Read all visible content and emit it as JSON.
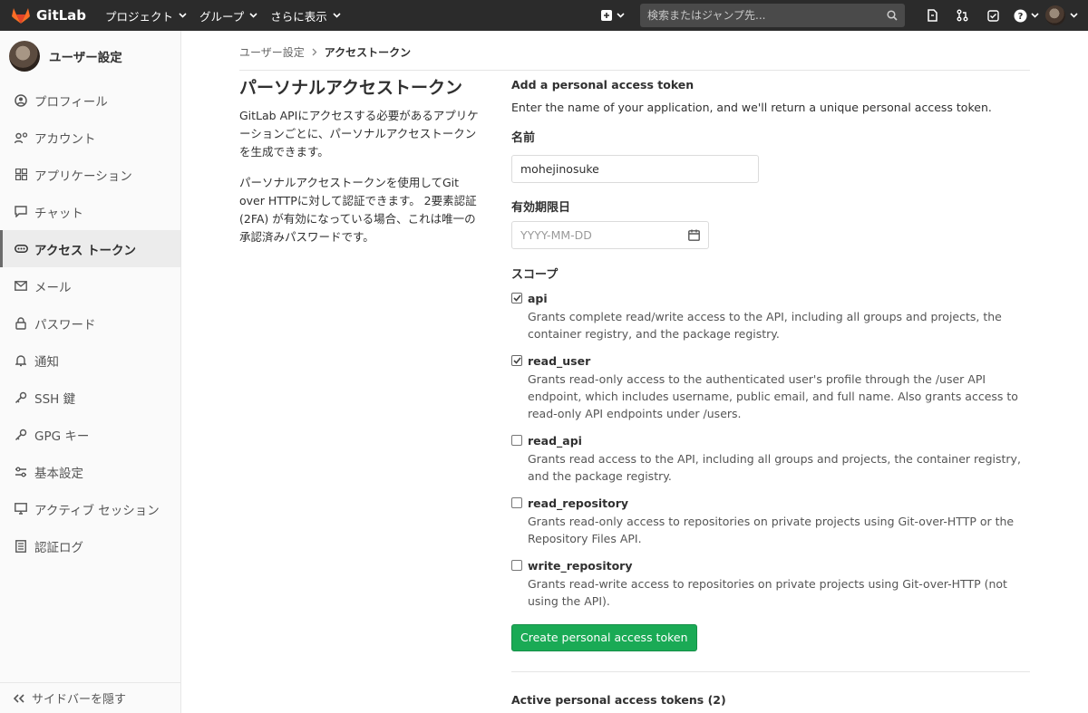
{
  "navbar": {
    "brand": "GitLab",
    "menus": [
      {
        "label": "プロジェクト"
      },
      {
        "label": "グループ"
      },
      {
        "label": "さらに表示"
      }
    ],
    "search_placeholder": "検索またはジャンプ先...",
    "icons": [
      "plus-icon",
      "search-icon",
      "todo-icon",
      "merge-request-icon",
      "issue-icon",
      "help-icon",
      "user-avatar"
    ]
  },
  "sidebar": {
    "title": "ユーザー設定",
    "items": [
      {
        "label": "プロフィール",
        "icon": "profile-icon"
      },
      {
        "label": "アカウント",
        "icon": "account-icon"
      },
      {
        "label": "アプリケーション",
        "icon": "applications-icon"
      },
      {
        "label": "チャット",
        "icon": "chat-icon"
      },
      {
        "label": "アクセス トークン",
        "icon": "token-icon",
        "active": true
      },
      {
        "label": "メール",
        "icon": "mail-icon"
      },
      {
        "label": "パスワード",
        "icon": "lock-icon"
      },
      {
        "label": "通知",
        "icon": "bell-icon"
      },
      {
        "label": "SSH 鍵",
        "icon": "key-icon"
      },
      {
        "label": "GPG キー",
        "icon": "key-icon"
      },
      {
        "label": "基本設定",
        "icon": "preferences-icon"
      },
      {
        "label": "アクティブ セッション",
        "icon": "monitor-icon"
      },
      {
        "label": "認証ログ",
        "icon": "log-icon"
      }
    ],
    "collapse_label": "サイドバーを隠す"
  },
  "breadcrumb": {
    "parent": "ユーザー設定",
    "current": "アクセストークン"
  },
  "intro": {
    "title": "パーソナルアクセストークン",
    "desc1": "GitLab APIにアクセスする必要があるアプリケーションごとに、パーソナルアクセストークンを生成できます。",
    "desc2": "パーソナルアクセストークンを使用してGit over HTTPに対して認証できます。 2要素認証(2FA) が有効になっている場合、これは唯一の承認済みパスワードです。"
  },
  "form": {
    "heading": "Add a personal access token",
    "subheading": "Enter the name of your application, and we'll return a unique personal access token.",
    "name_label": "名前",
    "name_value": "mohejinosuke",
    "expires_label": "有効期限日",
    "expires_placeholder": "YYYY-MM-DD",
    "scopes_label": "スコープ",
    "scopes": [
      {
        "name": "api",
        "checked": true,
        "desc": "Grants complete read/write access to the API, including all groups and projects, the container registry, and the package registry."
      },
      {
        "name": "read_user",
        "checked": true,
        "desc": "Grants read-only access to the authenticated user's profile through the /user API endpoint, which includes username, public email, and full name. Also grants access to read-only API endpoints under /users."
      },
      {
        "name": "read_api",
        "checked": false,
        "desc": "Grants read access to the API, including all groups and projects, the container registry, and the package registry."
      },
      {
        "name": "read_repository",
        "checked": false,
        "desc": "Grants read-only access to repositories on private projects using Git-over-HTTP or the Repository Files API."
      },
      {
        "name": "write_repository",
        "checked": false,
        "desc": "Grants read-write access to repositories on private projects using Git-over-HTTP (not using the API)."
      }
    ],
    "submit_label": "Create personal access token",
    "active_tokens_label": "Active personal access tokens (2)"
  },
  "colors": {
    "navbar_bg": "#2b2b2b",
    "primary_button": "#1aaa55",
    "logo_orange": "#e24329"
  }
}
